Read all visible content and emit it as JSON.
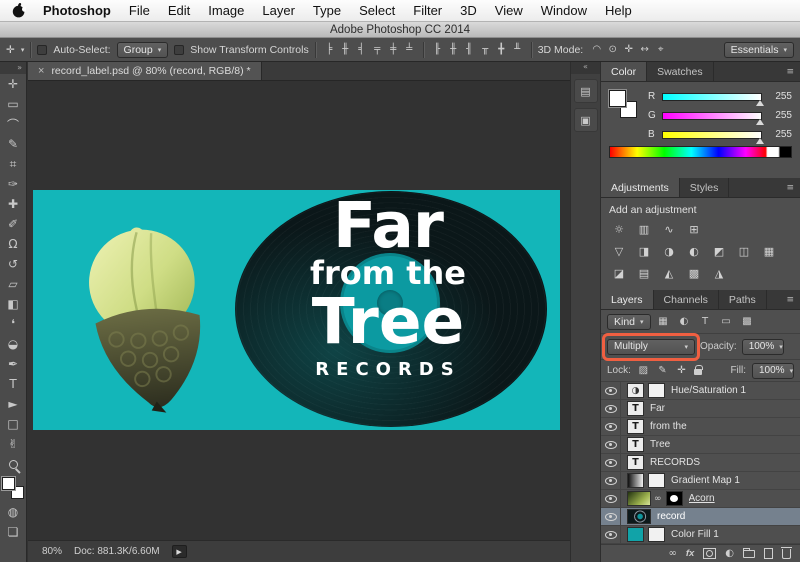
{
  "ui": {
    "dropdown_glyph": "▾",
    "panel_menu_glyph": "≡",
    "tools_header_glyph": "»",
    "dock_header_glyph": "«",
    "link_glyph": "∞",
    "adjust_badge_glyph": "◐"
  },
  "menubar": {
    "items": [
      "Photoshop",
      "File",
      "Edit",
      "Image",
      "Layer",
      "Type",
      "Select",
      "Filter",
      "3D",
      "View",
      "Window",
      "Help"
    ]
  },
  "titlebar": {
    "title": "Adobe Photoshop CC 2014"
  },
  "options_bar": {
    "tool_glyph": "✛",
    "auto_select_label": "Auto-Select:",
    "auto_select_value": "Group",
    "show_transform_label": "Show Transform Controls",
    "align_icons": [
      "╞",
      "╫",
      "╡",
      "╤",
      "╪",
      "╧"
    ],
    "distribute_icons": [
      "╟",
      "╫",
      "╢",
      "╥",
      "╋",
      "╨"
    ],
    "mode_3d_label": "3D Mode:",
    "mode_3d_icons": [
      "◠",
      "⊙",
      "✛",
      "↔",
      "⌖"
    ],
    "workspace_value": "Essentials"
  },
  "tools": [
    {
      "name": "move",
      "glyph": "✛"
    },
    {
      "name": "rectangular-marquee",
      "glyph": "▭"
    },
    {
      "name": "lasso",
      "glyph": "⌒"
    },
    {
      "name": "quick-selection",
      "glyph": "✎"
    },
    {
      "name": "crop",
      "glyph": "⌗"
    },
    {
      "name": "eyedropper",
      "glyph": "✑"
    },
    {
      "name": "spot-healing-brush",
      "glyph": "✚"
    },
    {
      "name": "brush",
      "glyph": "✐"
    },
    {
      "name": "clone-stamp",
      "glyph": "Ω"
    },
    {
      "name": "history-brush",
      "glyph": "↺"
    },
    {
      "name": "eraser",
      "glyph": "▱"
    },
    {
      "name": "gradient",
      "glyph": "◧"
    },
    {
      "name": "blur",
      "glyph": "❛"
    },
    {
      "name": "dodge",
      "glyph": "◒"
    },
    {
      "name": "pen",
      "glyph": "✒"
    },
    {
      "name": "type",
      "glyph": "T"
    },
    {
      "name": "path-selection",
      "glyph": "►"
    },
    {
      "name": "rectangle",
      "glyph": "□"
    },
    {
      "name": "hand",
      "glyph": "✌"
    },
    {
      "name": "zoom"
    },
    {
      "name": "quick-mask",
      "glyph": "◍"
    },
    {
      "name": "screen-mode",
      "glyph": "❏"
    }
  ],
  "doc_tab": {
    "close_glyph": "×",
    "title": "record_label.psd @ 80% (record, RGB/8) *"
  },
  "mini_dock": {
    "icons": [
      {
        "name": "history-panel",
        "glyph": "▤"
      },
      {
        "name": "properties-panel",
        "glyph": "▣"
      }
    ]
  },
  "artwork": {
    "title_line1": "Far",
    "title_line2": "from the",
    "title_line3": "Tree",
    "title_line4": "RECORDS",
    "colors": {
      "background_teal": "#13b6b9",
      "record": "#0b1719",
      "label_teal": "#0c9aa1",
      "text": "#ffffff"
    }
  },
  "color_panel": {
    "tabs": [
      "Color",
      "Swatches"
    ],
    "channels": [
      {
        "label": "R",
        "value": "255"
      },
      {
        "label": "G",
        "value": "255"
      },
      {
        "label": "B",
        "value": "255"
      }
    ]
  },
  "adjustments_panel": {
    "tabs": [
      "Adjustments",
      "Styles"
    ],
    "heading": "Add an adjustment",
    "row1": [
      "☼",
      "▥",
      "∿",
      "⊞"
    ],
    "row2": [
      "▽",
      "◨",
      "◑",
      "◐",
      "◩",
      "◫",
      "▦"
    ],
    "row3": [
      "◪",
      "▤",
      "◭",
      "▩",
      "◮"
    ]
  },
  "layers_panel": {
    "tabs": [
      "Layers",
      "Channels",
      "Paths"
    ],
    "filter_label": "Kind",
    "filter_icons": [
      "▦",
      "◐",
      "T",
      "▭",
      "▩"
    ],
    "blend_mode": "Multiply",
    "opacity_label": "Opacity:",
    "opacity_value": "100%",
    "lock_label": "Lock:",
    "lock_icons": [
      "▨",
      "✎",
      "✛"
    ],
    "fill_label": "Fill:",
    "fill_value": "100%",
    "selected_row_color": "#75818e",
    "layers": [
      {
        "name": "Hue/Saturation 1",
        "type": "adjustment",
        "thumb_glyph": "◑"
      },
      {
        "name": "Far",
        "type": "text",
        "thumb_glyph": "T"
      },
      {
        "name": "from the",
        "type": "text",
        "thumb_glyph": "T"
      },
      {
        "name": "Tree",
        "type": "text",
        "thumb_glyph": "T"
      },
      {
        "name": "RECORDS",
        "type": "text",
        "thumb_glyph": "T"
      },
      {
        "name": "Gradient Map 1",
        "type": "adjustment"
      },
      {
        "name": "Acorn",
        "type": "image"
      },
      {
        "name": "record",
        "type": "image",
        "selected": true
      },
      {
        "name": "Color Fill 1",
        "type": "fill"
      }
    ],
    "footer": {
      "fx_label": "fx"
    }
  },
  "status_bar": {
    "zoom": "80%",
    "doc_label": "Doc: 881.3K/6.60M",
    "play_glyph": "▶"
  },
  "annotation": {
    "purpose": "highlight around blend-mode dropdown",
    "color": "#ef5f41"
  }
}
